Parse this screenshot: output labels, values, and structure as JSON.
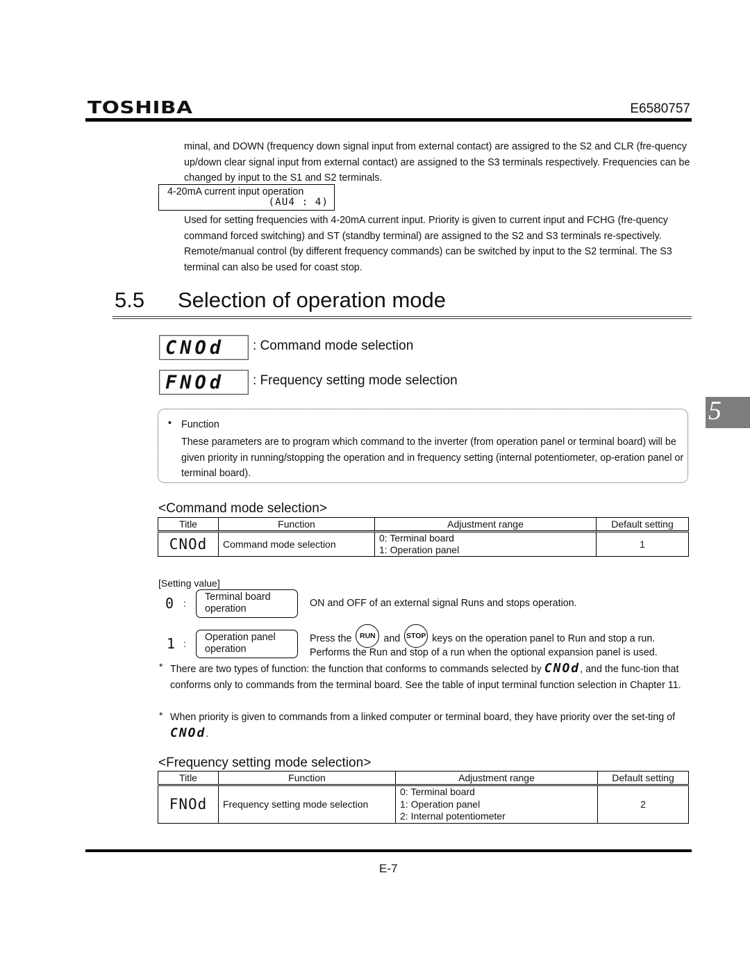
{
  "header": {
    "logo": "TOSHIBA",
    "doc_number": "E6580757"
  },
  "intro": {
    "paragraph1": "minal, and DOWN (frequency down signal input from external contact) are assigred to the S2 and CLR (fre-quency up/down clear signal input from external contact) are assigned to the S3 terminals respectively. Frequencies can be changed by input to the S1 and S2 terminals.",
    "box_label": "4-20mA current input operation",
    "box_code": "(AU4 : 4)",
    "paragraph2": "Used for setting frequencies with 4-20mA current input. Priority is given to current input and FCHG (fre-quency command forced switching) and ST (standby terminal) are assigned to the S2 and S3 terminals re-spectively. Remote/manual control (by different frequency commands) can be switched by input to the S2 terminal. The S3 terminal can also be used for coast stop."
  },
  "section": {
    "number": "5.5",
    "title": "Selection of operation mode",
    "chapter_tab": "5"
  },
  "parameters": [
    {
      "code": "CNOd",
      "label": ": Command mode selection"
    },
    {
      "code": "FNOd",
      "label": ": Frequency setting mode selection"
    }
  ],
  "function_box": {
    "bullet": "•",
    "title": "Function",
    "body": "These parameters are to program which command to the inverter (from operation panel or terminal board) will be given priority in running/stopping the operation and in frequency setting (internal potentiometer, op-eration panel or terminal board)."
  },
  "command_table": {
    "heading": "<Command mode selection>",
    "columns": [
      "Title",
      "Function",
      "Adjustment range",
      "Default setting"
    ],
    "row": {
      "title": "CNOd",
      "function": "Command mode selection",
      "range": [
        "0: Terminal board",
        "1: Operation panel"
      ],
      "default": "1"
    }
  },
  "setting_value": {
    "label": "[Setting value]",
    "items": [
      {
        "value": "0",
        "colon": ":",
        "name": "Terminal board operation",
        "desc": "ON and OFF of an external signal Runs and stops operation."
      },
      {
        "value": "1",
        "colon": ":",
        "name": "Operation panel operation",
        "desc_prefix": "Press the",
        "key_run": "RUN",
        "desc_and": "and",
        "key_stop": "STOP",
        "desc_suffix": "keys on the operation panel to Run and stop a run.",
        "desc_line2": "Performs the Run and stop of a run when the optional expansion panel is used."
      }
    ]
  },
  "notes": [
    {
      "star": "*",
      "before": "There are two types of function: the function that conforms to commands selected by ",
      "code": "CNOd",
      "after": ", and the func-tion that conforms only to commands from the terminal board. See the table of input terminal function selection in Chapter 11."
    },
    {
      "star": "*",
      "before": "When priority is given to commands from a linked computer or terminal board, they have priority over the set-ting of ",
      "code": "CNOd",
      "after": "."
    }
  ],
  "frequency_table": {
    "heading": "<Frequency setting mode selection>",
    "columns": [
      "Title",
      "Function",
      "Adjustment range",
      "Default setting"
    ],
    "row": {
      "title": "FNOd",
      "function": "Frequency setting mode selection",
      "range": [
        "0: Terminal board",
        "1: Operation panel",
        "2: Internal potentiometer"
      ],
      "default": "2"
    }
  },
  "footer": {
    "page_number": "E-7"
  }
}
